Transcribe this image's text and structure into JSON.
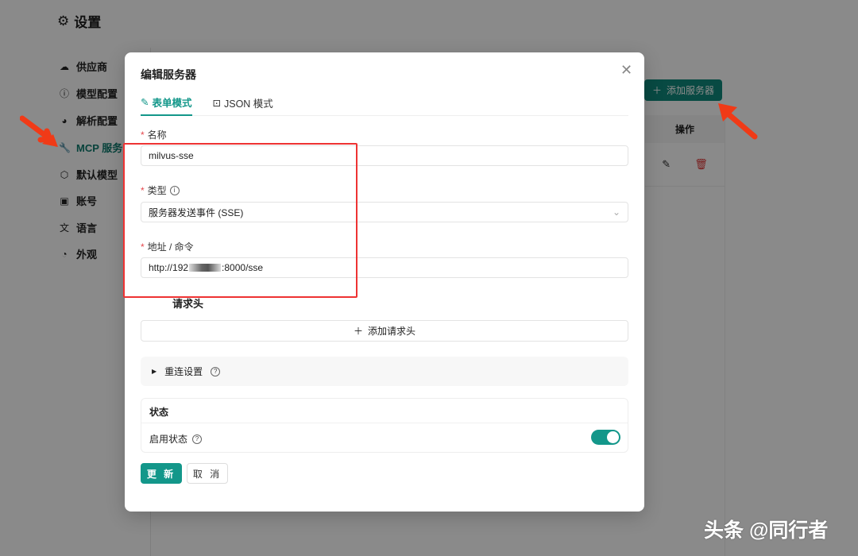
{
  "page": {
    "title": "设置"
  },
  "sidebar": {
    "items": [
      {
        "label": "供应商",
        "icon": "cloud-icon"
      },
      {
        "label": "模型配置",
        "icon": "model-icon"
      },
      {
        "label": "解析配置",
        "icon": "palette-icon"
      },
      {
        "label": "MCP 服务",
        "icon": "wrench-icon"
      },
      {
        "label": "默认模型",
        "icon": "cube-icon"
      },
      {
        "label": "账号",
        "icon": "account-icon"
      },
      {
        "label": "语言",
        "icon": "translate-icon"
      },
      {
        "label": "外观",
        "icon": "appearance-icon"
      }
    ]
  },
  "main": {
    "add_server": "添加服务器",
    "table_header_actions": "操作"
  },
  "modal": {
    "title": "编辑服务器",
    "tabs": [
      {
        "label": "表单模式"
      },
      {
        "label": "JSON 模式"
      }
    ],
    "name_label": "名称",
    "name_value": "milvus-sse",
    "type_label": "类型",
    "type_value": "服务器发送事件 (SSE)",
    "address_label": "地址 / 命令",
    "address_prefix": "http://192",
    "address_suffix": ":8000/sse",
    "headers_label": "请求头",
    "add_header": "添加请求头",
    "reconnect_label": "重连设置",
    "status_title": "状态",
    "enable_label": "启用状态",
    "enabled": true,
    "update_button": "更 新",
    "cancel_button": "取 消"
  },
  "watermark": "头条 @同行者"
}
